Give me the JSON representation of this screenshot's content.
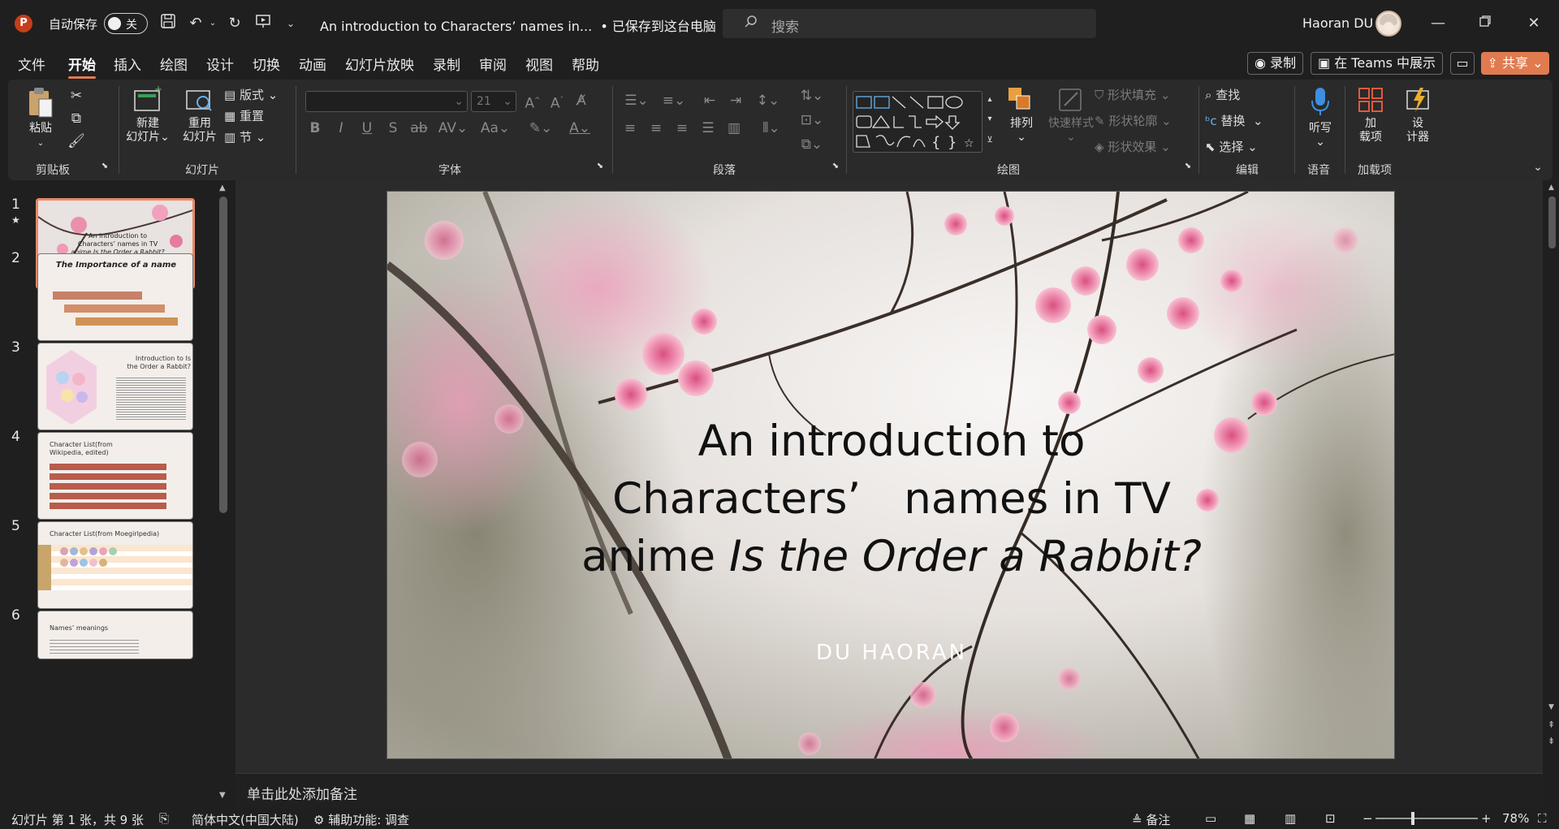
{
  "titlebar": {
    "autosave_label": "自动保存",
    "autosave_state": "关",
    "document_title": "An introduction to Characters’ names in...",
    "save_status": "• 已保存到这台电脑",
    "search_placeholder": "搜索",
    "user_name": "Haoran DU"
  },
  "menu": {
    "tabs": [
      "文件",
      "开始",
      "插入",
      "绘图",
      "设计",
      "切换",
      "动画",
      "幻灯片放映",
      "录制",
      "审阅",
      "视图",
      "帮助"
    ],
    "active_tab": "开始",
    "record_label": "录制",
    "teams_label": "在 Teams 中展示",
    "share_label": "共享"
  },
  "ribbon": {
    "clipboard": {
      "label": "剪贴板",
      "paste": "粘贴"
    },
    "slides": {
      "label": "幻灯片",
      "new_slide_1": "新建",
      "new_slide_2": "幻灯片",
      "reuse_1": "重用",
      "reuse_2": "幻灯片",
      "layout": "版式",
      "reset": "重置",
      "section": "节"
    },
    "font": {
      "label": "字体",
      "font_size": "21"
    },
    "paragraph": {
      "label": "段落"
    },
    "drawing": {
      "label": "绘图",
      "arrange": "排列",
      "quick_styles": "快速样式",
      "shape_fill": "形状填充",
      "shape_outline": "形状轮廓",
      "shape_effects": "形状效果"
    },
    "editing": {
      "label": "编辑",
      "find": "查找",
      "replace": "替换",
      "select": "选择"
    },
    "voice": {
      "label": "语音",
      "dictate": "听写"
    },
    "addins": {
      "label": "加载项",
      "addins_1": "加",
      "addins_2": "载项",
      "designer_1": "设",
      "designer_2": "计器"
    }
  },
  "slides_panel": {
    "numbers": [
      "1",
      "2",
      "3",
      "4",
      "5",
      "6"
    ],
    "s2_title": "The Importance of a name",
    "s3_title_1": "Introduction to Is",
    "s3_title_2": "the Order a Rabbit?",
    "s4_title": "Character List(from Wikipedia, edited)",
    "s5_title": "Character List(from Moegirlpedia)",
    "s6_title": "Names’ meanings"
  },
  "slide": {
    "title_line1": "An introduction to",
    "title_line2": "Characters’　names in TV",
    "title_line3_prefix": "anime ",
    "title_line3_italic": "Is the Order a Rabbit?",
    "subtitle": "DU HAORAN"
  },
  "notes": {
    "placeholder": "单击此处添加备注"
  },
  "statusbar": {
    "slide_info": "幻灯片 第 1 张，共 9 张",
    "language": "简体中文(中国大陆)",
    "accessibility": "辅助功能: 调查",
    "notes_label": "备注",
    "zoom": "78%"
  },
  "colors": {
    "accent": "#e07b50",
    "background": "#1f1f1f",
    "ribbon": "#2a2a2a"
  }
}
